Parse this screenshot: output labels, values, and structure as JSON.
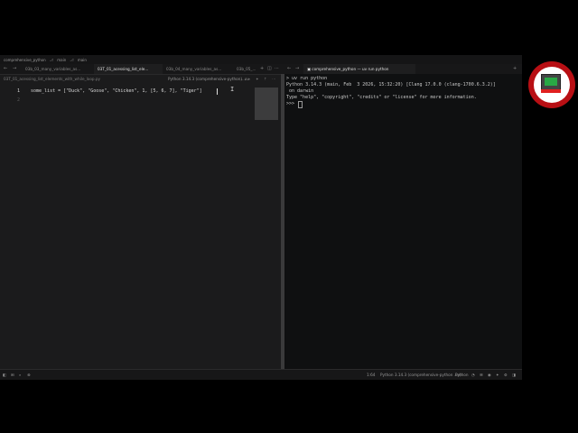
{
  "window": {
    "title": "comprehensive_python",
    "branch1": "main",
    "branch2": "main"
  },
  "tabs": [
    {
      "label": "03b_03_many_variables_as..."
    },
    {
      "label": "03T_01_acessing_list_ele...",
      "active": true
    },
    {
      "label": "03b_04_many_variables_as..."
    },
    {
      "label": "03b_05_..."
    }
  ],
  "terminal_tab": {
    "label": "comprehensive_python — uv run python"
  },
  "editor": {
    "filename": "03T_01_acessing_list_elements_with_while_loop.py",
    "interpreter": "Python 3.14.3 (comprehensive-python) .uv",
    "lines": [
      {
        "num": "1",
        "text": "some_list = [\"Duck\", \"Goose\", \"Chicken\", 1, [5, 6, 7], \"Tiger\"]"
      },
      {
        "num": "2",
        "text": ""
      }
    ]
  },
  "terminal": {
    "lines": [
      "> uv run python",
      "Python 3.14.3 (main, Feb  3 2026, 15:32:20) [Clang 17.0.0 (clang-1700.6.3.2)]",
      " on darwin",
      "Type \"help\", \"copyright\", \"credits\" or \"license\" for more information.",
      ">>> "
    ]
  },
  "status": {
    "position": "1:64",
    "interpreter": "Python 3.14.3 (comprehensive-python .uv)",
    "language": "Python"
  },
  "colors": {
    "brand": "#b80f14",
    "editor_bg": "#1b1b1c",
    "terminal_bg": "#0f1011"
  }
}
